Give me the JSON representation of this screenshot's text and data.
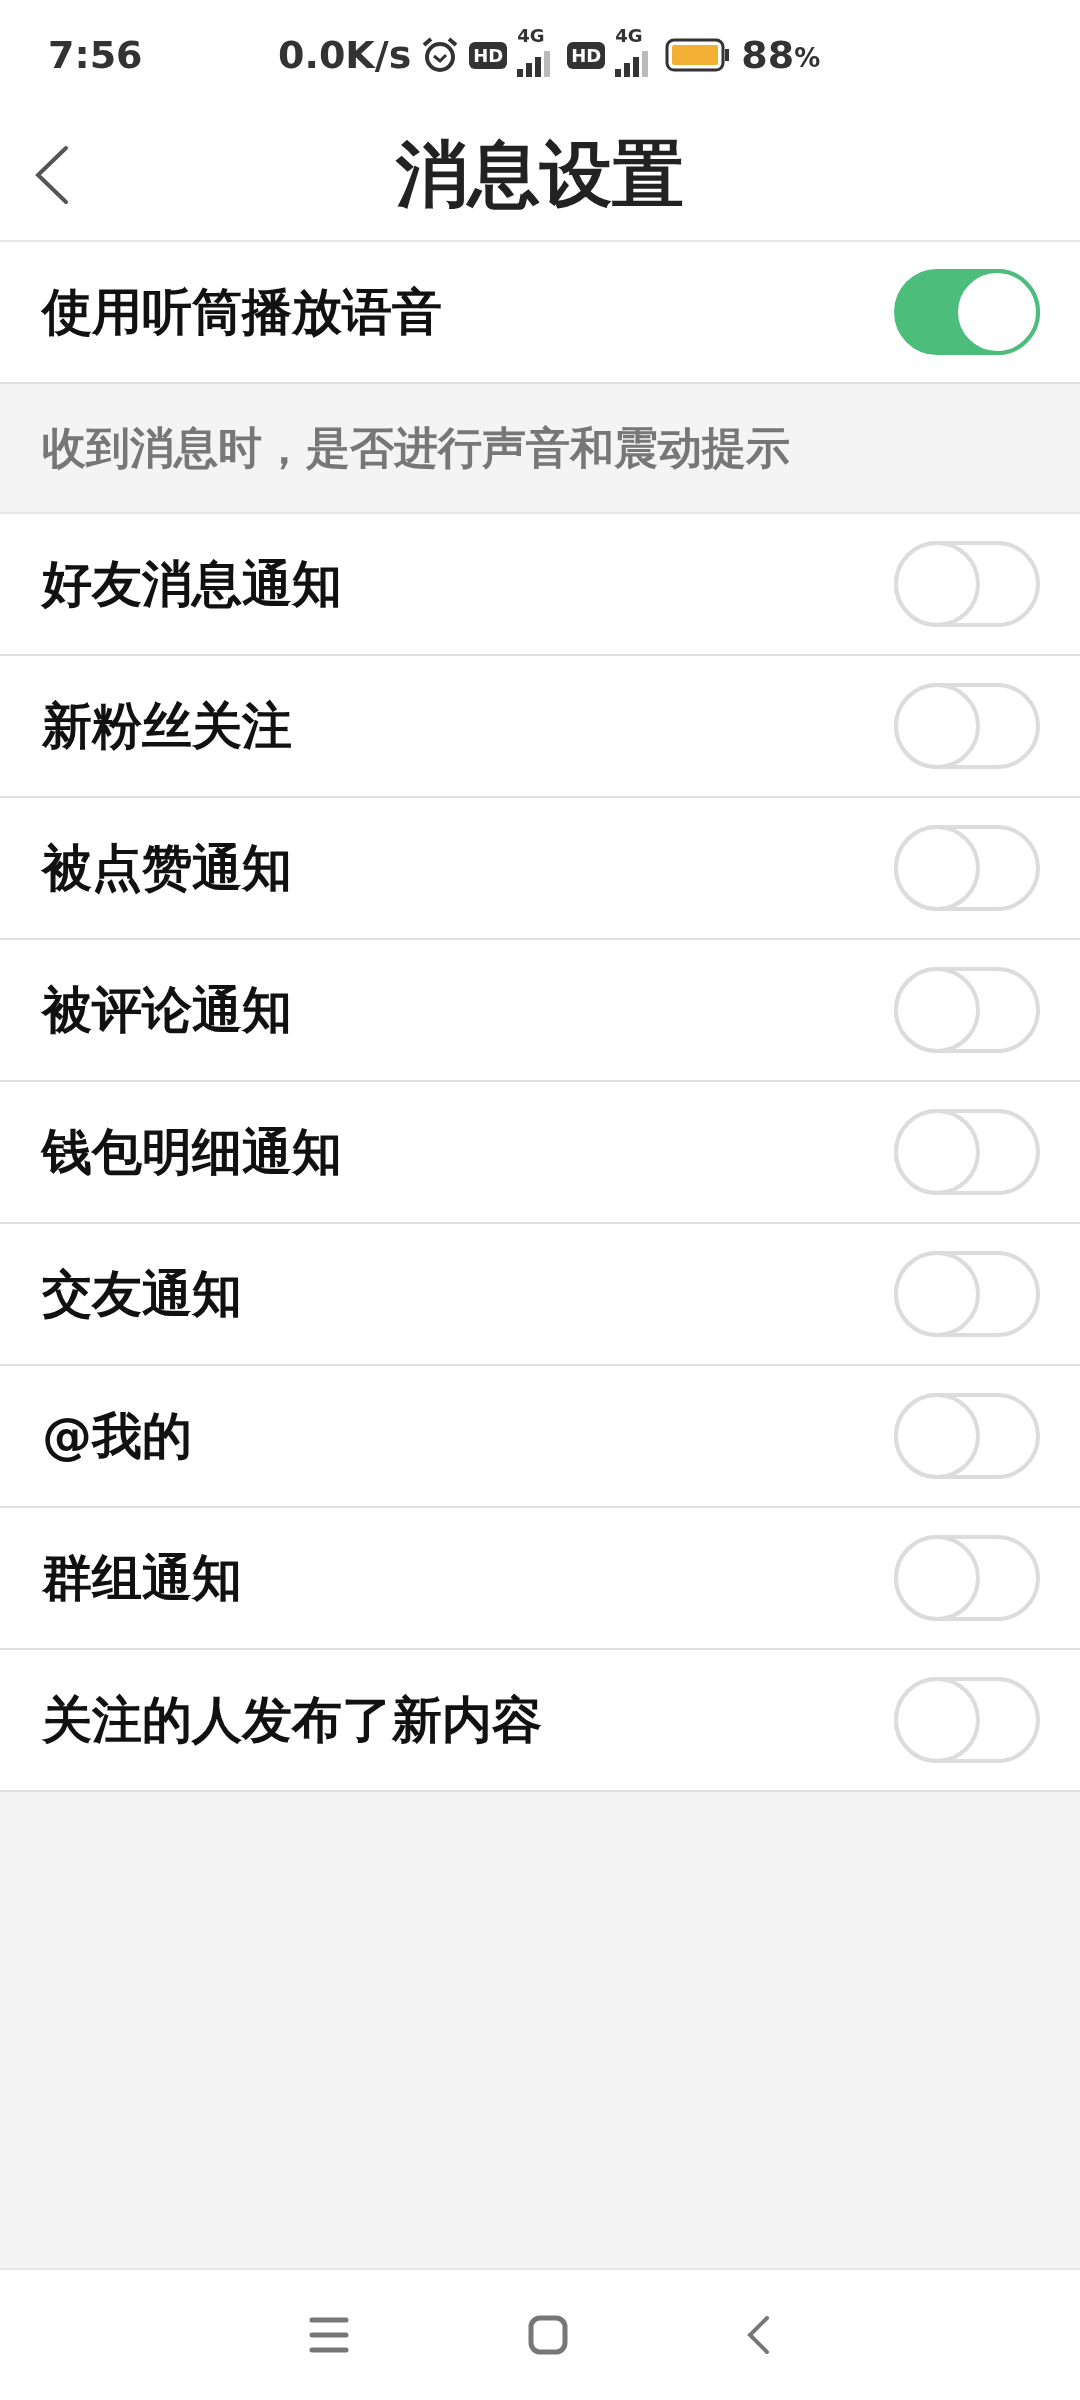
{
  "status_bar": {
    "time": "7:56",
    "speed": "0.0K/s",
    "sims": [
      {
        "badge": "HD",
        "network": "4G"
      },
      {
        "badge": "HD",
        "network": "4G"
      }
    ],
    "battery_value": "88",
    "battery_unit": "%"
  },
  "header": {
    "title": "消息设置"
  },
  "top_settings": [
    {
      "label": "使用听筒播放语音",
      "on": true
    }
  ],
  "section_note": "收到消息时，是否进行声音和震动提示",
  "notification_settings": [
    {
      "label": "好友消息通知",
      "on": false
    },
    {
      "label": "新粉丝关注",
      "on": false
    },
    {
      "label": "被点赞通知",
      "on": false
    },
    {
      "label": "被评论通知",
      "on": false
    },
    {
      "label": "钱包明细通知",
      "on": false
    },
    {
      "label": "交友通知",
      "on": false
    },
    {
      "label": "@我的",
      "on": false
    },
    {
      "label": "群组通知",
      "on": false
    },
    {
      "label": "关注的人发布了新内容",
      "on": false
    }
  ]
}
